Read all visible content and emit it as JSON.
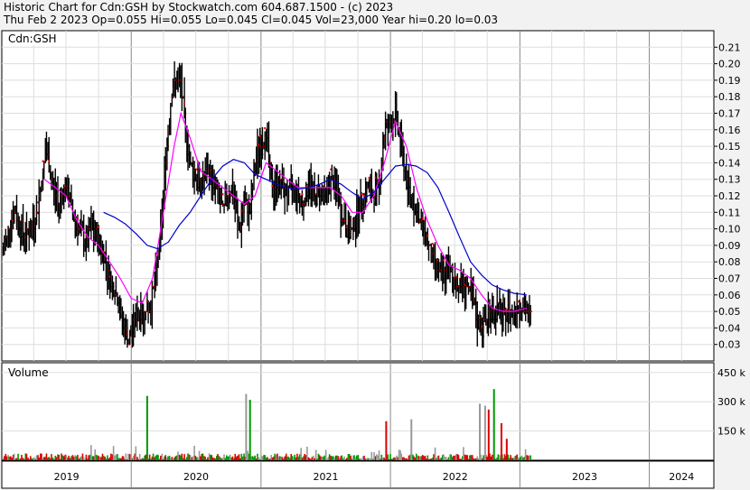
{
  "header": {
    "line1": "Historic Chart for Cdn:GSH by Stockwatch.com 604.687.1500 - (c) 2023",
    "line2": "Thu Feb  2 2023  Op=0.055  Hi=0.055  Lo=0.045  Cl=0.045  Vol=23,000  Year hi=0.20  lo=0.03"
  },
  "chart_data": [
    {
      "type": "bar",
      "subtype": "ohlc-price",
      "panel_label": "Cdn:GSH",
      "ylim": [
        0.02,
        0.22
      ],
      "y_ticks": [
        "0.21",
        "0.20",
        "0.19",
        "0.18",
        "0.17",
        "0.16",
        "0.15",
        "0.14",
        "0.13",
        "0.12",
        "0.11",
        "0.10",
        "0.09",
        "0.08",
        "0.07",
        "0.06",
        "0.05",
        "0.04",
        "0.03"
      ],
      "xlim": [
        "2019-01-01",
        "2024-07-01"
      ],
      "x_ticks": [
        "2019",
        "2020",
        "2021",
        "2022",
        "2023",
        "2024"
      ],
      "grid": true,
      "colors": {
        "bars": "#000000",
        "up_close": "#ff0000",
        "ma_short": "#ff00ff",
        "ma_long": "#0000cc"
      },
      "series": [
        {
          "type": "ohlc",
          "points": [
            [
              "2019-01-05",
              0.085
            ],
            [
              "2019-01-25",
              0.105
            ],
            [
              "2019-02-10",
              0.11
            ],
            [
              "2019-02-25",
              0.1
            ],
            [
              "2019-03-10",
              0.095
            ],
            [
              "2019-03-25",
              0.1
            ],
            [
              "2019-04-10",
              0.11
            ],
            [
              "2019-04-25",
              0.13
            ],
            [
              "2019-05-05",
              0.15
            ],
            [
              "2019-05-15",
              0.14
            ],
            [
              "2019-05-25",
              0.125
            ],
            [
              "2019-06-10",
              0.115
            ],
            [
              "2019-06-25",
              0.125
            ],
            [
              "2019-07-10",
              0.12
            ],
            [
              "2019-07-25",
              0.105
            ],
            [
              "2019-08-10",
              0.1
            ],
            [
              "2019-08-25",
              0.09
            ],
            [
              "2019-09-10",
              0.1
            ],
            [
              "2019-09-25",
              0.095
            ],
            [
              "2019-10-15",
              0.085
            ],
            [
              "2019-11-01",
              0.07
            ],
            [
              "2019-11-20",
              0.06
            ],
            [
              "2019-12-10",
              0.04
            ],
            [
              "2019-12-25",
              0.03
            ],
            [
              "2020-01-10",
              0.045
            ],
            [
              "2020-01-25",
              0.05
            ],
            [
              "2020-02-10",
              0.05
            ],
            [
              "2020-02-25",
              0.055
            ],
            [
              "2020-03-10",
              0.07
            ],
            [
              "2020-03-25",
              0.1
            ],
            [
              "2020-04-10",
              0.15
            ],
            [
              "2020-04-25",
              0.185
            ],
            [
              "2020-05-10",
              0.19
            ],
            [
              "2020-05-20",
              0.19
            ],
            [
              "2020-06-01",
              0.16
            ],
            [
              "2020-06-15",
              0.14
            ],
            [
              "2020-07-01",
              0.13
            ],
            [
              "2020-07-15",
              0.125
            ],
            [
              "2020-08-01",
              0.135
            ],
            [
              "2020-08-15",
              0.13
            ],
            [
              "2020-09-01",
              0.12
            ],
            [
              "2020-09-15",
              0.11
            ],
            [
              "2020-10-01",
              0.125
            ],
            [
              "2020-10-15",
              0.12
            ],
            [
              "2020-11-01",
              0.1
            ],
            [
              "2020-11-15",
              0.115
            ],
            [
              "2020-12-01",
              0.11
            ],
            [
              "2020-12-15",
              0.14
            ],
            [
              "2021-01-01",
              0.15
            ],
            [
              "2021-01-15",
              0.16
            ],
            [
              "2021-02-01",
              0.12
            ],
            [
              "2021-02-15",
              0.13
            ],
            [
              "2021-03-01",
              0.125
            ],
            [
              "2021-03-15",
              0.12
            ],
            [
              "2021-04-01",
              0.125
            ],
            [
              "2021-04-15",
              0.12
            ],
            [
              "2021-05-01",
              0.115
            ],
            [
              "2021-05-15",
              0.13
            ],
            [
              "2021-06-01",
              0.12
            ],
            [
              "2021-06-15",
              0.125
            ],
            [
              "2021-07-01",
              0.12
            ],
            [
              "2021-07-15",
              0.13
            ],
            [
              "2021-08-01",
              0.125
            ],
            [
              "2021-08-15",
              0.11
            ],
            [
              "2021-09-01",
              0.1
            ],
            [
              "2021-09-15",
              0.1
            ],
            [
              "2021-10-01",
              0.11
            ],
            [
              "2021-10-15",
              0.12
            ],
            [
              "2021-11-01",
              0.125
            ],
            [
              "2021-11-15",
              0.12
            ],
            [
              "2021-12-01",
              0.125
            ],
            [
              "2021-12-15",
              0.16
            ],
            [
              "2022-01-01",
              0.165
            ],
            [
              "2022-01-15",
              0.17
            ],
            [
              "2022-02-01",
              0.15
            ],
            [
              "2022-02-15",
              0.13
            ],
            [
              "2022-03-01",
              0.12
            ],
            [
              "2022-03-15",
              0.11
            ],
            [
              "2022-04-01",
              0.1
            ],
            [
              "2022-04-15",
              0.095
            ],
            [
              "2022-05-01",
              0.08
            ],
            [
              "2022-05-15",
              0.075
            ],
            [
              "2022-06-01",
              0.07
            ],
            [
              "2022-06-15",
              0.075
            ],
            [
              "2022-07-01",
              0.07
            ],
            [
              "2022-07-15",
              0.065
            ],
            [
              "2022-08-01",
              0.065
            ],
            [
              "2022-08-15",
              0.06
            ],
            [
              "2022-09-01",
              0.045
            ],
            [
              "2022-09-15",
              0.04
            ],
            [
              "2022-10-01",
              0.045
            ],
            [
              "2022-10-15",
              0.05
            ],
            [
              "2022-11-01",
              0.05
            ],
            [
              "2022-11-15",
              0.045
            ],
            [
              "2022-12-01",
              0.05
            ],
            [
              "2022-12-15",
              0.05
            ],
            [
              "2023-01-05",
              0.055
            ],
            [
              "2023-01-20",
              0.05
            ],
            [
              "2023-02-02",
              0.045
            ]
          ]
        },
        {
          "type": "moving-average",
          "color": "#ff00ff",
          "points": [
            [
              "2019-05-01",
              0.13
            ],
            [
              "2019-06-01",
              0.125
            ],
            [
              "2019-07-01",
              0.12
            ],
            [
              "2019-08-01",
              0.105
            ],
            [
              "2019-09-01",
              0.095
            ],
            [
              "2019-10-01",
              0.09
            ],
            [
              "2019-11-01",
              0.08
            ],
            [
              "2019-12-01",
              0.07
            ],
            [
              "2020-01-01",
              0.058
            ],
            [
              "2020-02-01",
              0.055
            ],
            [
              "2020-03-01",
              0.07
            ],
            [
              "2020-04-01",
              0.11
            ],
            [
              "2020-05-01",
              0.15
            ],
            [
              "2020-05-20",
              0.17
            ],
            [
              "2020-06-15",
              0.155
            ],
            [
              "2020-07-15",
              0.135
            ],
            [
              "2020-08-15",
              0.13
            ],
            [
              "2020-09-15",
              0.125
            ],
            [
              "2020-10-15",
              0.12
            ],
            [
              "2020-11-15",
              0.115
            ],
            [
              "2020-12-15",
              0.12
            ],
            [
              "2021-01-15",
              0.14
            ],
            [
              "2021-02-15",
              0.135
            ],
            [
              "2021-03-15",
              0.13
            ],
            [
              "2021-04-15",
              0.125
            ],
            [
              "2021-05-15",
              0.125
            ],
            [
              "2021-06-15",
              0.125
            ],
            [
              "2021-07-15",
              0.125
            ],
            [
              "2021-08-15",
              0.12
            ],
            [
              "2021-09-15",
              0.11
            ],
            [
              "2021-10-15",
              0.11
            ],
            [
              "2021-11-15",
              0.12
            ],
            [
              "2021-12-15",
              0.14
            ],
            [
              "2022-01-15",
              0.165
            ],
            [
              "2022-02-15",
              0.15
            ],
            [
              "2022-03-15",
              0.125
            ],
            [
              "2022-04-15",
              0.105
            ],
            [
              "2022-05-15",
              0.09
            ],
            [
              "2022-06-15",
              0.078
            ],
            [
              "2022-07-15",
              0.075
            ],
            [
              "2022-08-15",
              0.07
            ],
            [
              "2022-09-15",
              0.06
            ],
            [
              "2022-10-15",
              0.052
            ],
            [
              "2022-11-15",
              0.05
            ],
            [
              "2022-12-15",
              0.05
            ],
            [
              "2023-01-20",
              0.052
            ]
          ]
        },
        {
          "type": "moving-average",
          "color": "#0000cc",
          "points": [
            [
              "2019-10-15",
              0.11
            ],
            [
              "2019-11-15",
              0.107
            ],
            [
              "2019-12-15",
              0.103
            ],
            [
              "2020-01-15",
              0.097
            ],
            [
              "2020-02-15",
              0.09
            ],
            [
              "2020-03-15",
              0.088
            ],
            [
              "2020-04-15",
              0.092
            ],
            [
              "2020-05-15",
              0.102
            ],
            [
              "2020-06-15",
              0.11
            ],
            [
              "2020-07-15",
              0.12
            ],
            [
              "2020-08-15",
              0.13
            ],
            [
              "2020-09-15",
              0.138
            ],
            [
              "2020-10-15",
              0.142
            ],
            [
              "2020-11-15",
              0.14
            ],
            [
              "2020-12-15",
              0.133
            ],
            [
              "2021-01-15",
              0.13
            ],
            [
              "2021-02-15",
              0.127
            ],
            [
              "2021-03-15",
              0.125
            ],
            [
              "2021-04-15",
              0.124
            ],
            [
              "2021-05-15",
              0.125
            ],
            [
              "2021-06-15",
              0.127
            ],
            [
              "2021-07-15",
              0.13
            ],
            [
              "2021-08-15",
              0.127
            ],
            [
              "2021-09-15",
              0.122
            ],
            [
              "2021-10-15",
              0.118
            ],
            [
              "2021-11-15",
              0.122
            ],
            [
              "2021-12-15",
              0.13
            ],
            [
              "2022-01-15",
              0.138
            ],
            [
              "2022-02-15",
              0.139
            ],
            [
              "2022-03-15",
              0.138
            ],
            [
              "2022-04-15",
              0.134
            ],
            [
              "2022-05-15",
              0.125
            ],
            [
              "2022-06-15",
              0.11
            ],
            [
              "2022-07-15",
              0.095
            ],
            [
              "2022-08-15",
              0.08
            ],
            [
              "2022-09-15",
              0.072
            ],
            [
              "2022-10-15",
              0.066
            ],
            [
              "2022-11-15",
              0.063
            ],
            [
              "2022-12-15",
              0.061
            ],
            [
              "2023-01-20",
              0.06
            ]
          ]
        }
      ]
    },
    {
      "type": "bar",
      "subtype": "volume",
      "panel_label": "Volume",
      "ylim": [
        0,
        500000
      ],
      "y_ticks": [
        "450 k",
        "300 k",
        "150 k"
      ],
      "colors": {
        "up": "#009900",
        "down": "#dd0000",
        "flat": "#999999"
      },
      "spikes": [
        [
          "2020-02-15",
          330000,
          "up"
        ],
        [
          "2020-11-20",
          340000,
          "flat"
        ],
        [
          "2020-12-01",
          310000,
          "up"
        ],
        [
          "2021-12-20",
          200000,
          "down"
        ],
        [
          "2022-03-01",
          210000,
          "flat"
        ],
        [
          "2022-09-10",
          290000,
          "flat"
        ],
        [
          "2022-09-25",
          280000,
          "flat"
        ],
        [
          "2022-10-05",
          260000,
          "down"
        ],
        [
          "2022-10-20",
          365000,
          "up"
        ],
        [
          "2022-11-10",
          190000,
          "down"
        ],
        [
          "2022-11-25",
          110000,
          "down"
        ]
      ]
    }
  ]
}
